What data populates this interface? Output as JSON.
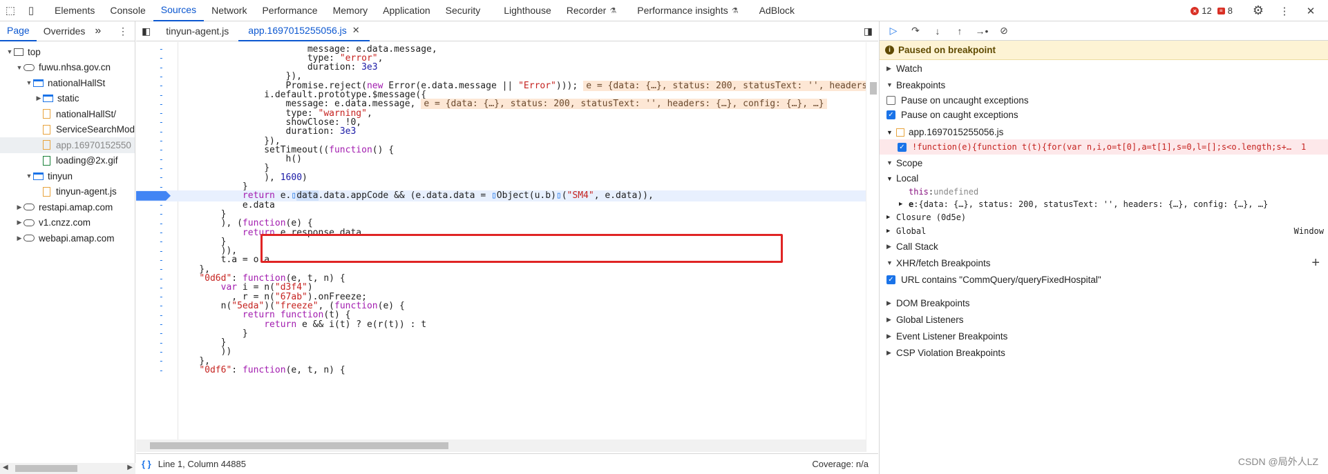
{
  "topbar": {
    "tabs": [
      "Elements",
      "Console",
      "Sources",
      "Network",
      "Performance",
      "Memory",
      "Application",
      "Security",
      "Lighthouse",
      "Recorder",
      "Performance insights",
      "AdBlock"
    ],
    "active_tab": "Sources",
    "errors": "12",
    "warnings": "8"
  },
  "navigator": {
    "tabs": [
      "Page",
      "Overrides"
    ],
    "more": "»",
    "tree": [
      {
        "label": "top",
        "depth": 0,
        "icon": "box",
        "arrow": "▼"
      },
      {
        "label": "fuwu.nhsa.gov.cn",
        "depth": 1,
        "icon": "cloud",
        "arrow": "▼"
      },
      {
        "label": "nationalHallSt",
        "depth": 2,
        "icon": "folder",
        "arrow": "▼"
      },
      {
        "label": "static",
        "depth": 3,
        "icon": "folder",
        "arrow": "▶"
      },
      {
        "label": "nationalHallSt/",
        "depth": 3,
        "icon": "file",
        "arrow": ""
      },
      {
        "label": "ServiceSearchMod",
        "depth": 3,
        "icon": "file",
        "arrow": ""
      },
      {
        "label": "app.16970152550",
        "depth": 3,
        "icon": "file",
        "arrow": "",
        "selected": true
      },
      {
        "label": "loading@2x.gif",
        "depth": 3,
        "icon": "image",
        "arrow": ""
      },
      {
        "label": "tinyun",
        "depth": 2,
        "icon": "folder",
        "arrow": "▼"
      },
      {
        "label": "tinyun-agent.js",
        "depth": 3,
        "icon": "file",
        "arrow": ""
      },
      {
        "label": "restapi.amap.com",
        "depth": 1,
        "icon": "cloud",
        "arrow": "▶"
      },
      {
        "label": "v1.cnzz.com",
        "depth": 1,
        "icon": "cloud",
        "arrow": "▶"
      },
      {
        "label": "webapi.amap.com",
        "depth": 1,
        "icon": "cloud",
        "arrow": "▶"
      }
    ]
  },
  "editor": {
    "tabs": [
      "tinyun-agent.js",
      "app.1697015255056.js"
    ],
    "active_tab": "app.1697015255056.js",
    "status_position": "Line 1, Column 44885",
    "coverage": "Coverage: n/a"
  },
  "code_lines": [
    "                        message: e.data.message,",
    "                        type: \"error\",",
    "                        duration: 3e3",
    "                    }),",
    "                    Promise.reject(new Error(e.data.message || \"Error\")));",
    "                i.default.prototype.$message({",
    "                    message: e.data.message,",
    "                    type: \"warning\",",
    "                    showClose: !0,",
    "                    duration: 3e3",
    "                }),",
    "                setTimeout((function() {",
    "                    h()",
    "                }",
    "                ), 1600)",
    "            }",
    "            return e.data.data.appCode && (e.data.data = Object(u.b)(\"SM4\", e.data)),",
    "            e.data",
    "        }",
    "        ), (function(e) {",
    "            return e.response.data",
    "        }",
    "        )),",
    "        t.a = o.a",
    "    },",
    "    \"0d6d\": function(e, t, n) {",
    "        var i = n(\"d3f4\")",
    "          , r = n(\"67ab\").onFreeze;",
    "        n(\"5eda\")(\"freeze\", (function(e) {",
    "            return function(t) {",
    "                return e && i(t) ? e(r(t)) : t",
    "            }",
    "        }",
    "        ))",
    "    },",
    "    \"0df6\": function(e, t, n) {"
  ],
  "inline_values": {
    "line5": "e = {data: {…}, status: 200, statusText: '', headers:",
    "line7": "e = {data: {…}, status: 200, statusText: '', headers: {…}, config: {…}, …}"
  },
  "debugger": {
    "paused": "Paused on breakpoint",
    "sections": {
      "watch": "Watch",
      "breakpoints": "Breakpoints",
      "scope": "Scope",
      "call_stack": "Call Stack",
      "xhr": "XHR/fetch Breakpoints",
      "dom": "DOM Breakpoints",
      "global_listeners": "Global Listeners",
      "event_listener": "Event Listener Breakpoints",
      "csp": "CSP Violation Breakpoints"
    },
    "pause_uncaught": "Pause on uncaught exceptions",
    "pause_caught": "Pause on caught exceptions",
    "bp_file": "app.1697015255056.js",
    "bp_code": "!function(e){function t(t){for(var n,i,o=t[0],a=t[1],s=0,l=[];s<o.length;s+…",
    "bp_line": "1",
    "scope": {
      "local": "Local",
      "this_key": "this",
      "this_val": "undefined",
      "e_key": "e",
      "e_val": "{data: {…}, status: 200, statusText: '', headers: {…}, config: {…}, …}",
      "closure": "Closure (0d5e)",
      "global": "Global",
      "global_val": "Window"
    },
    "xhr_url": "URL contains \"CommQuery/queryFixedHospital\""
  },
  "watermark": "CSDN @局外人LZ"
}
